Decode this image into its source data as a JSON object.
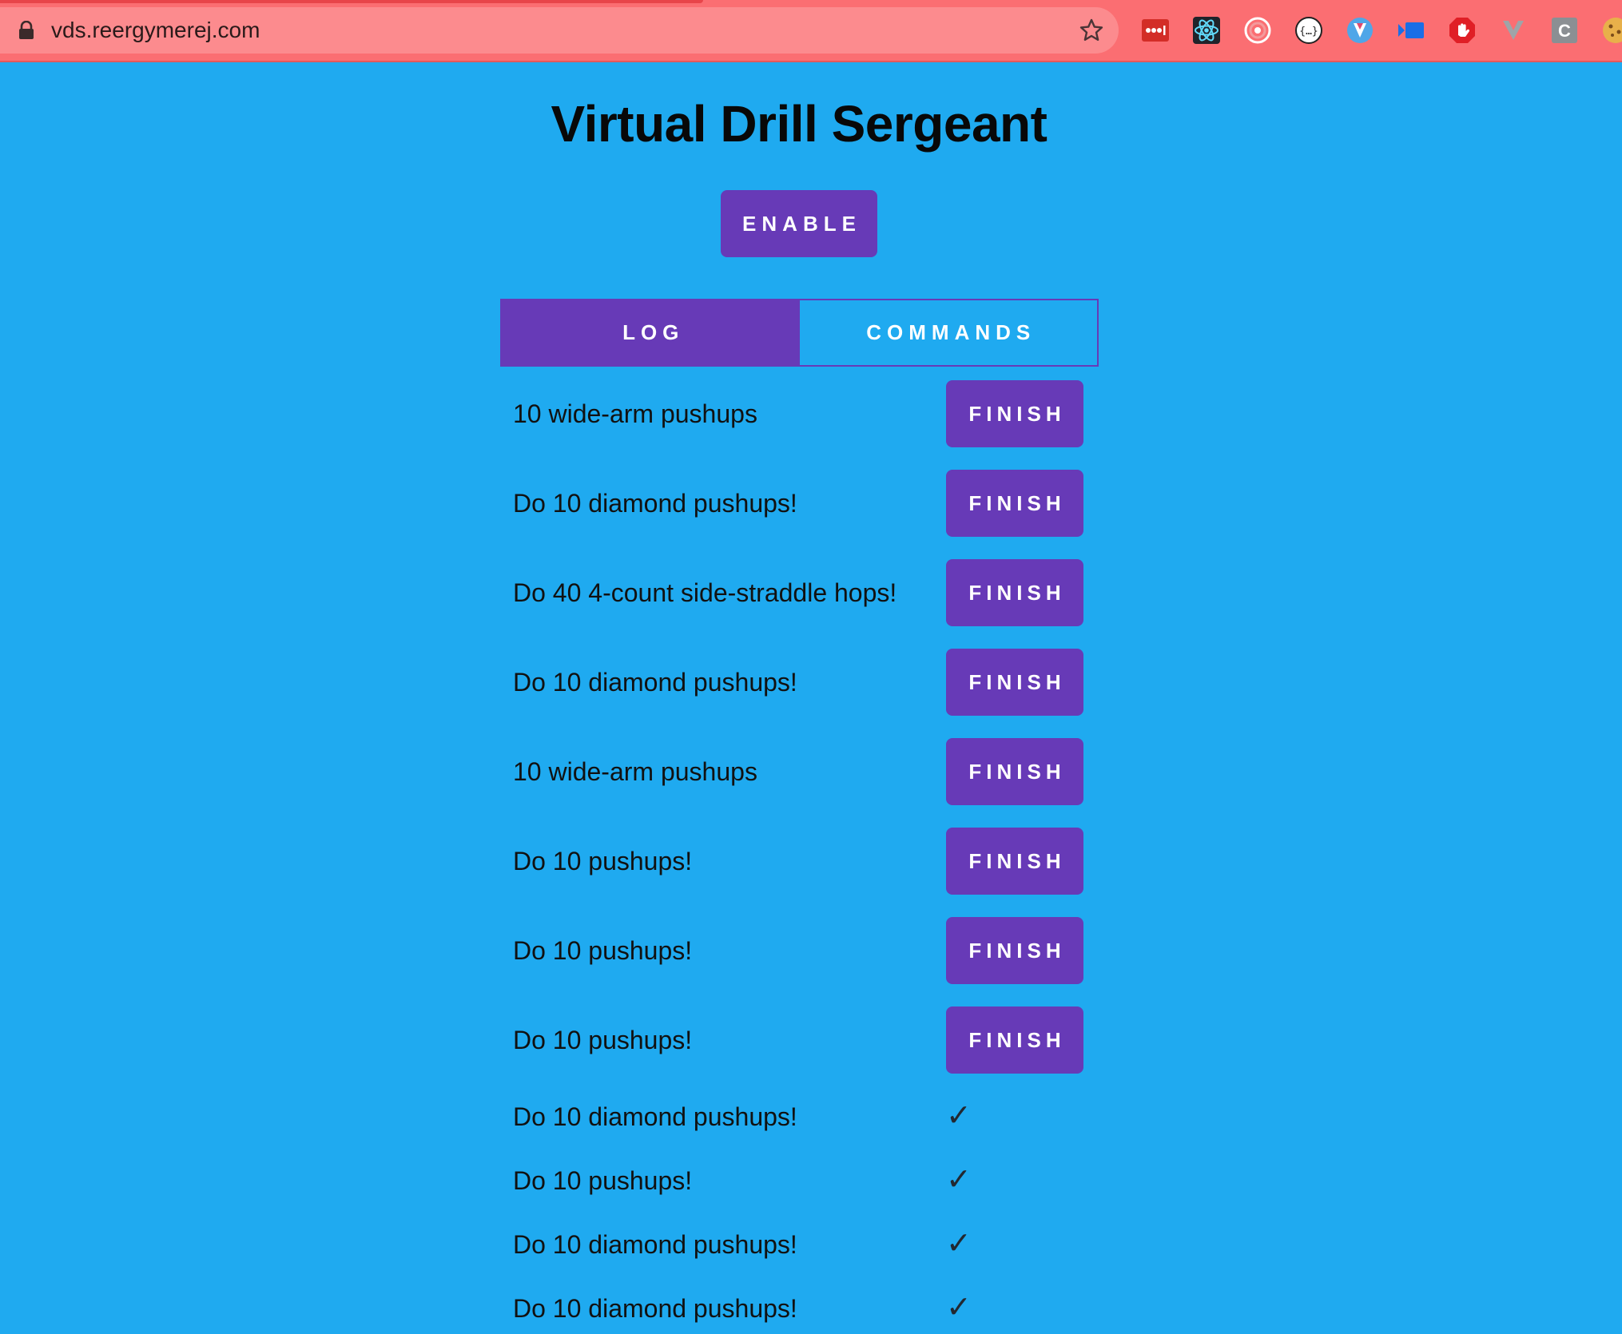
{
  "browser": {
    "url": "vds.reergymerej.com",
    "extensions": [
      "lastpass-icon",
      "react-devtools-icon",
      "target-icon",
      "json-viewer-icon",
      "vue-icon",
      "screencast-icon",
      "adblock-hand-icon",
      "vuetify-icon",
      "c-extension-icon",
      "cookie-icon"
    ]
  },
  "page": {
    "title": "Virtual Drill Sergeant",
    "enable_label": "ENABLE"
  },
  "tabs": [
    {
      "label": "LOG",
      "active": true
    },
    {
      "label": "COMMANDS",
      "active": false
    }
  ],
  "log": {
    "finish_label": "FINISH",
    "check_glyph": "✓",
    "items": [
      {
        "text": "10 wide-arm pushups",
        "done": false
      },
      {
        "text": "Do 10 diamond pushups!",
        "done": false
      },
      {
        "text": "Do 40 4-count side-straddle hops!",
        "done": false
      },
      {
        "text": "Do 10 diamond pushups!",
        "done": false
      },
      {
        "text": "10 wide-arm pushups",
        "done": false
      },
      {
        "text": "Do 10 pushups!",
        "done": false
      },
      {
        "text": "Do 10 pushups!",
        "done": false
      },
      {
        "text": "Do 10 pushups!",
        "done": false
      },
      {
        "text": "Do 10 diamond pushups!",
        "done": true
      },
      {
        "text": "Do 10 pushups!",
        "done": true
      },
      {
        "text": "Do 10 diamond pushups!",
        "done": true
      },
      {
        "text": "Do 10 diamond pushups!",
        "done": true
      }
    ]
  },
  "colors": {
    "background": "#1faaf0",
    "accent": "#673ab7",
    "browser_bar": "#fb6e72"
  }
}
